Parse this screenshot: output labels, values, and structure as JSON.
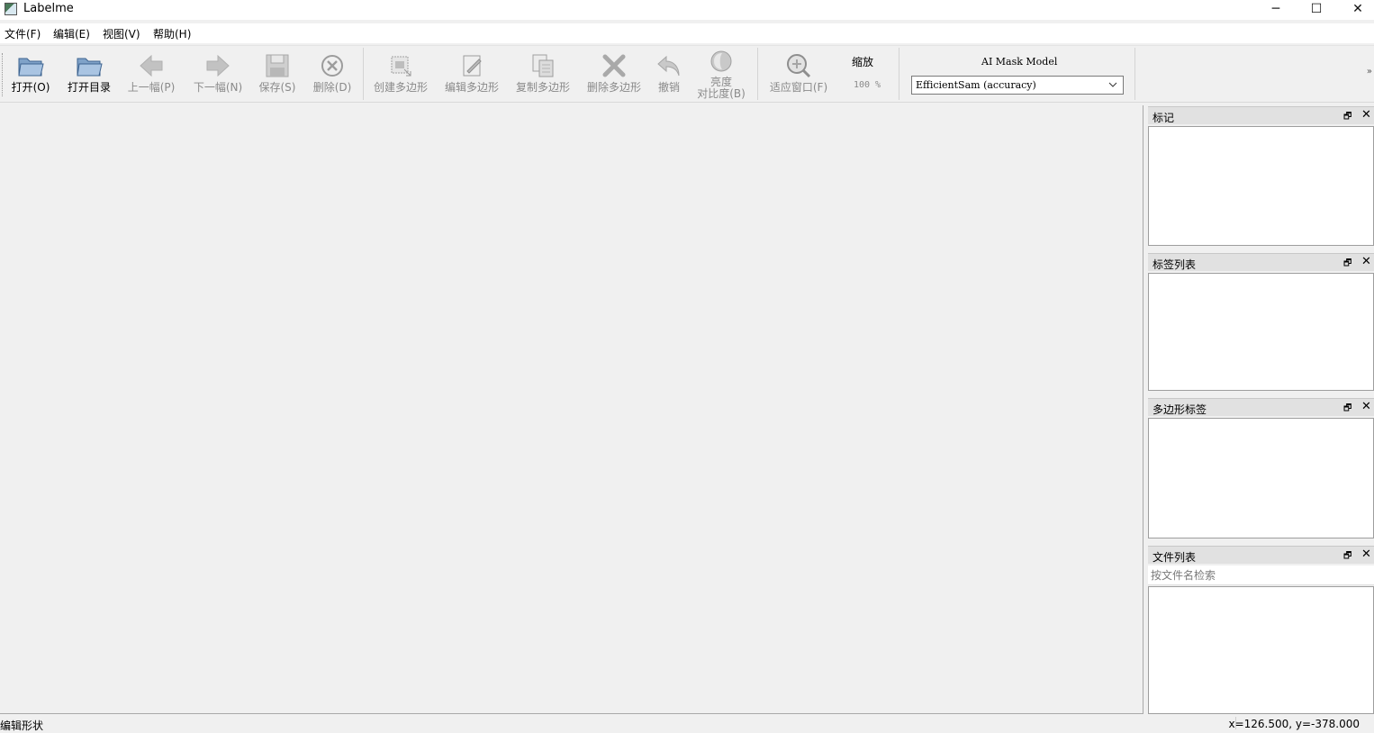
{
  "window": {
    "title": "Labelme",
    "minimize": "─",
    "maximize": "☐",
    "close": "✕"
  },
  "menu": [
    "文件(F)",
    "编辑(E)",
    "视图(V)",
    "帮助(H)"
  ],
  "toolbar": {
    "open": "打开(O)",
    "open_dir": "打开目录",
    "prev": "上一幅(P)",
    "next": "下一幅(N)",
    "save": "保存(S)",
    "delete_file": "删除(D)",
    "create_polygon": "创建多边形",
    "edit_polygon": "编辑多边形",
    "copy_polygon": "复制多边形",
    "delete_polygon": "删除多边形",
    "undo": "撤销",
    "brightness_line1": "亮度",
    "brightness_line2": "对比度(B)",
    "fit_window": "适应窗口(F)",
    "zoom_title": "缩放",
    "zoom_value": "100 %",
    "ai_title": "AI Mask Model",
    "ai_model": "EfficientSam (accuracy)",
    "extension": "»"
  },
  "docks": {
    "flags": "标记",
    "label_list": "标签列表",
    "polygon_labels": "多边形标签",
    "file_list": "文件列表",
    "file_search_placeholder": "按文件名检索",
    "float_icon": "🗗",
    "close_icon": "✕"
  },
  "status": {
    "message": "编辑形状",
    "coords": "x=126.500, y=-378.000"
  }
}
